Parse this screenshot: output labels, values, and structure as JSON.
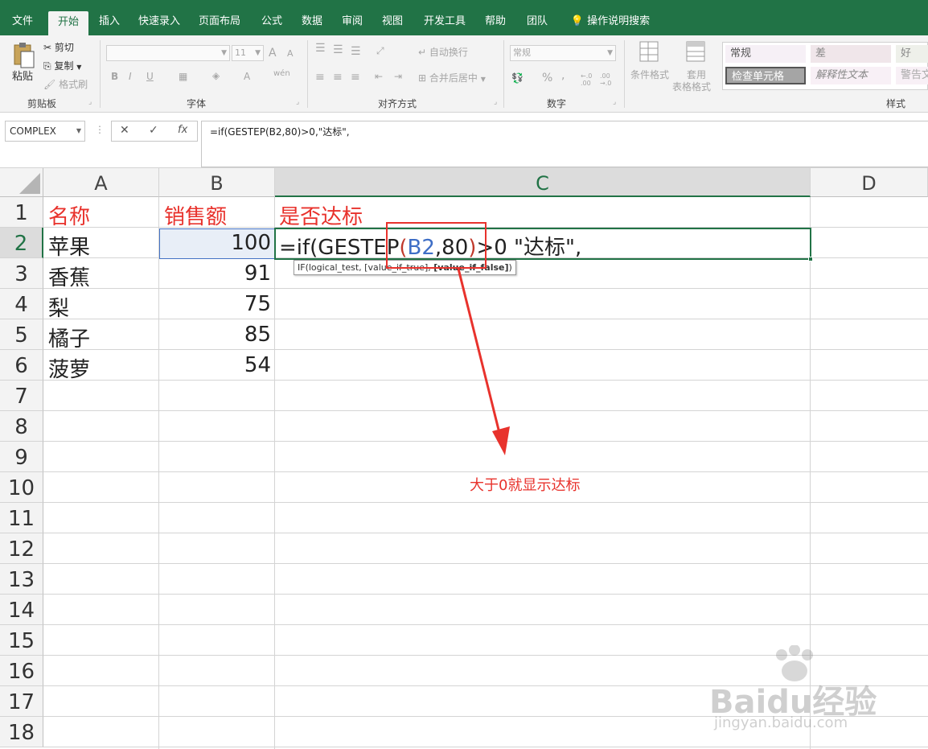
{
  "tabs": [
    "文件",
    "开始",
    "插入",
    "快速录入",
    "页面布局",
    "公式",
    "数据",
    "审阅",
    "视图",
    "开发工具",
    "帮助",
    "团队",
    "操作说明搜索"
  ],
  "ribbon": {
    "clipboard": {
      "paste": "粘贴",
      "cut": "剪切",
      "copy": "复制",
      "format_painter": "格式刷",
      "label": "剪贴板"
    },
    "font": {
      "size": "11",
      "label": "字体",
      "bold": "B",
      "italic": "I",
      "underline": "U",
      "grow": "A",
      "shrink": "A",
      "color_a": "A",
      "wen": "wén"
    },
    "alignment": {
      "wrap": "自动换行",
      "merge": "合并后居中",
      "label": "对齐方式"
    },
    "number": {
      "format": "常规",
      "percent": "%",
      "comma": ",",
      "label": "数字",
      "inc": "←.0 .00",
      "dec": ".00 →.0"
    },
    "styles": {
      "cond_format": "条件格式",
      "table_format_1": "套用",
      "table_format_2": "表格格式",
      "normal": "常规",
      "bad": "差",
      "good": "好",
      "check_cell": "检查单元格",
      "explanatory": "解释性文本",
      "warning": "警告文",
      "label": "样式"
    }
  },
  "formula_bar": {
    "name_box": "COMPLEX",
    "cancel": "✕",
    "enter": "✓",
    "fx": "fx",
    "formula": "=if(GESTEP(B2,80)>0,\"达标\","
  },
  "columns": [
    "A",
    "B",
    "C",
    "D"
  ],
  "rows": [
    "1",
    "2",
    "3",
    "4",
    "5",
    "6",
    "7",
    "8",
    "9",
    "10",
    "11",
    "12",
    "13",
    "14",
    "15",
    "16",
    "17",
    "18"
  ],
  "headers": {
    "a": "名称",
    "b": "销售额",
    "c": "是否达标"
  },
  "data": [
    {
      "name": "苹果",
      "sales": "100"
    },
    {
      "name": "香蕉",
      "sales": "91"
    },
    {
      "name": "梨",
      "sales": "75"
    },
    {
      "name": "橘子",
      "sales": "85"
    },
    {
      "name": "菠萝",
      "sales": "54"
    }
  ],
  "edit": {
    "p1": "=if(GESTEP",
    "p2": "(",
    "p3": "B2",
    ",p4": "",
    "p4a": ",80",
    "p5": ")",
    ">p6": "",
    "p6a": ">0 \"达标\","
  },
  "tooltip": {
    "t1": "IF(logical_test, [value_if_true], ",
    "t2": "[value_if_false]",
    "t3": ")"
  },
  "annotation": "大于0就显示达标",
  "watermark": {
    "brand": "Baidu经验",
    "url": "jingyan.baidu.com"
  },
  "colors": {
    "excel_green": "#217346",
    "annotation_red": "#e8322c",
    "ref_blue": "#3e6ec6",
    "ref_red": "#c0392b"
  }
}
